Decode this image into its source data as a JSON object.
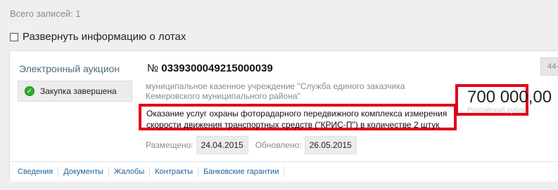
{
  "total": "Всего записей: 1",
  "expand_label": "Развернуть информацию о лотах",
  "card": {
    "procedure_type": "Электронный аукцион",
    "status": "Закупка завершена",
    "number_prefix": "№",
    "number": "0339300049215000039",
    "organization": "муниципальное казенное учреждение \"Служба единого заказчика Кемеровского муниципального района\"",
    "subject_line1": "Оказание услуг охраны фоторадарного передвижного комплекса измерения",
    "subject_line2": "скорости движения транспортных средств (\"КРИС-П\") в количестве 2 штук",
    "price": "700 000,00",
    "currency": "Российский рубль",
    "tag": "44-",
    "posted_label": "Размещено:",
    "posted_date": "24.04.2015",
    "updated_label": "Обновлено:",
    "updated_date": "26.05.2015"
  },
  "tabs": [
    "Сведения",
    "Документы",
    "Жалобы",
    "Контракты",
    "Банковские гарантии"
  ],
  "colors": {
    "highlight": "#e10019",
    "link": "#1e5f96",
    "status_ok": "#2eaa2e"
  }
}
